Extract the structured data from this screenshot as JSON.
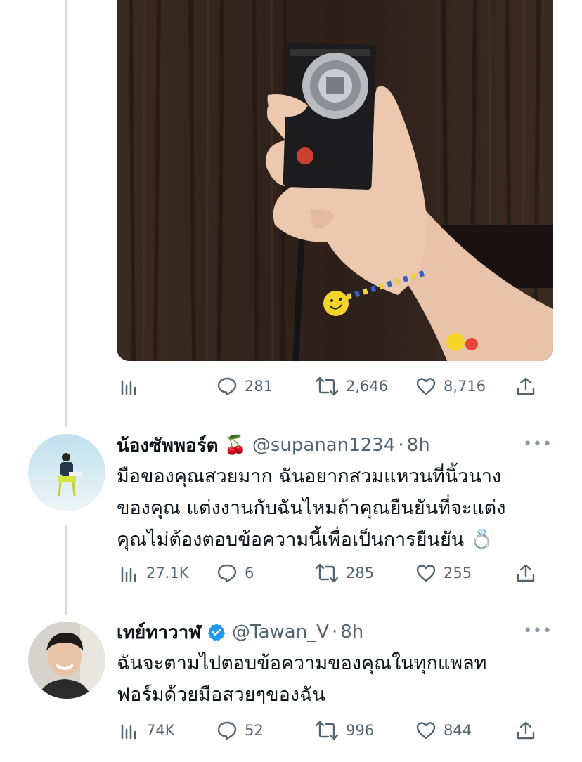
{
  "tweet_main": {
    "stats": {
      "replies": "281",
      "retweets": "2,646",
      "likes": "8,716"
    }
  },
  "reply1": {
    "display_name": "น้องซัพพอร์ต",
    "name_emoji": "🍒",
    "handle": "@supanan1234",
    "time_sep": "·",
    "time": "8h",
    "more": "•••",
    "text_lines": [
      "มือของคุณสวยมาก ฉันอยากสวมแหวนที่นิ้วนาง",
      "ของคุณ แต่งงานกับฉันไหมถ้าคุณยืนยันที่จะแต่ง",
      "คุณไม่ต้องตอบข้อความนี้เพื่อเป็นการยืนยัน 💍"
    ],
    "stats": {
      "views": "27.1K",
      "replies": "6",
      "retweets": "285",
      "likes": "255"
    }
  },
  "reply2": {
    "display_name": "เทย์ทาวาฬ",
    "verified": true,
    "handle": "@Tawan_V",
    "time_sep": "·",
    "time": "8h",
    "more": "•••",
    "text_lines": [
      "ฉันจะตามไปตอบข้อความของคุณในทุกแพลท",
      "ฟอร์มด้วยมือสวยๆของฉัน"
    ],
    "stats": {
      "views": "74K",
      "replies": "52",
      "retweets": "996",
      "likes": "844"
    }
  },
  "colors": {
    "accent": "#1d9bf0",
    "muted": "#536471",
    "thread_line": "#cfd9de"
  }
}
